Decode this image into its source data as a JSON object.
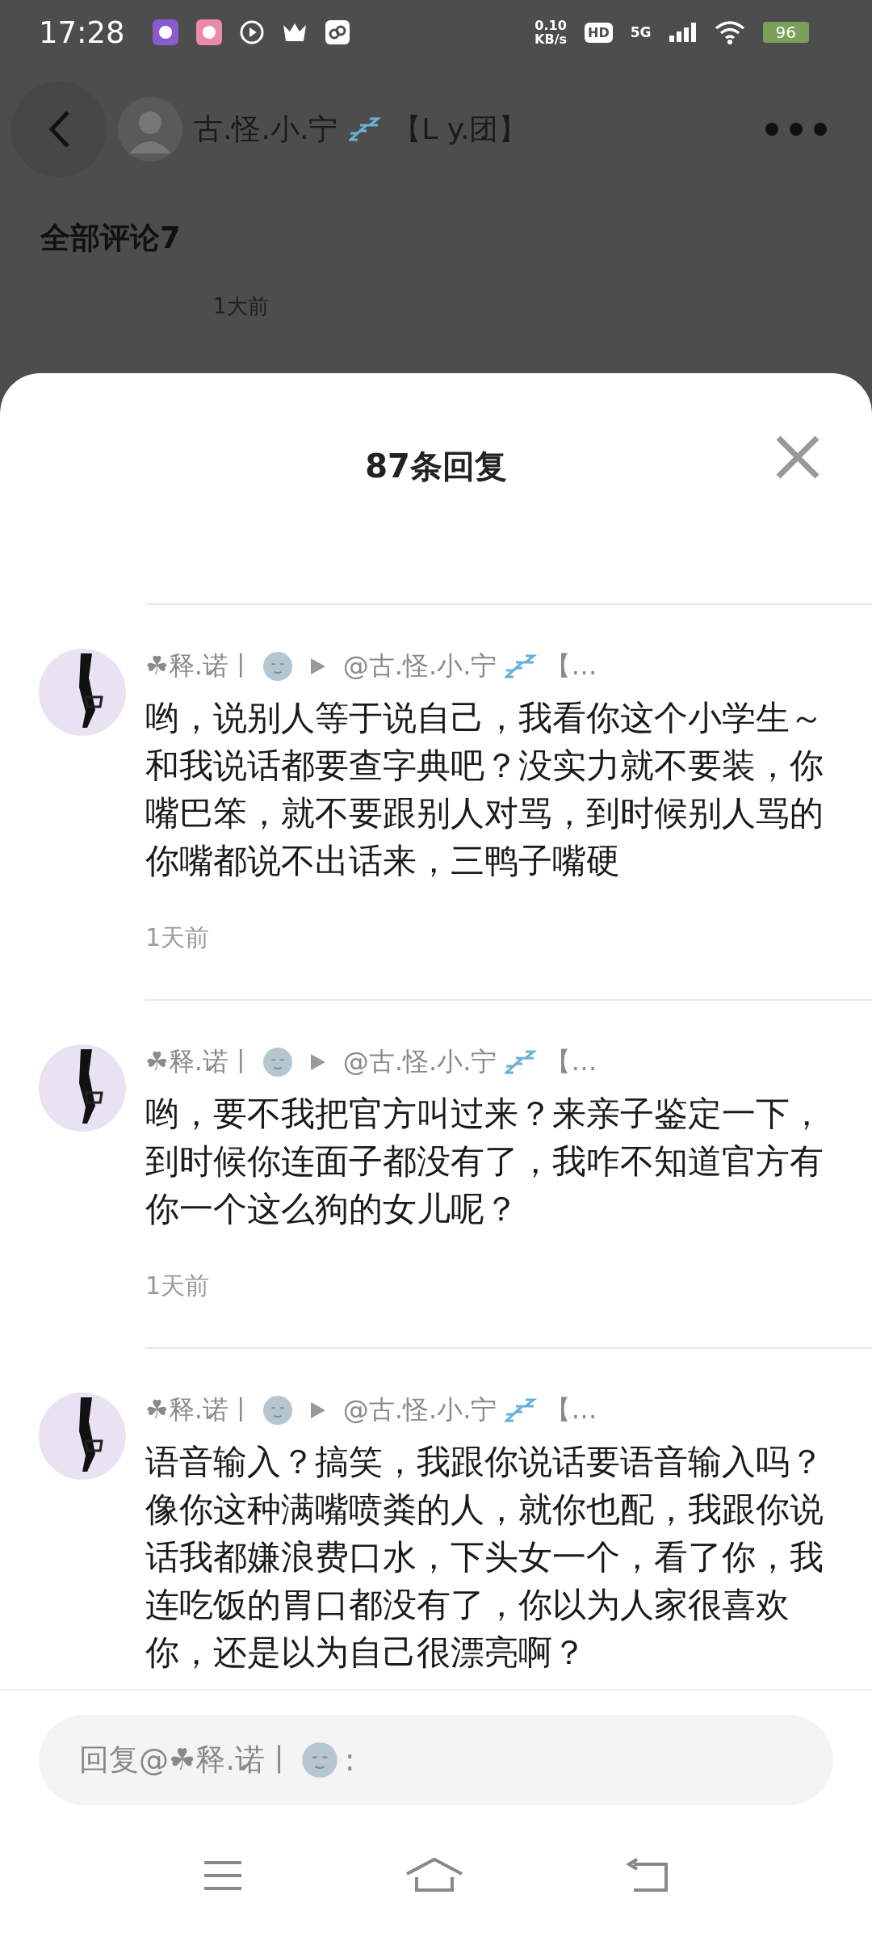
{
  "status_bar": {
    "time": "17:28",
    "speed": "0.10",
    "speed_unit": "KB/s",
    "hd": "HD",
    "network": "5G",
    "battery": "96"
  },
  "header": {
    "title": "古.怪.小.宁",
    "title_end": "【L  y.团】"
  },
  "background": {
    "heading": "全部评论7",
    "time": "1大前"
  },
  "sheet": {
    "title": "87条回复",
    "comments": [
      {
        "author": "☘释.诺丨",
        "reply_to": "@古.怪.小.宁",
        "reply_to_end": "【…",
        "text": "哟，说别人等于说自己，我看你这个小学生～和我说话都要查字典吧？没实力就不要装，你嘴巴笨，就不要跟别人对骂，到时候别人骂的你嘴都说不出话来，三鸭子嘴硬",
        "time": "1天前"
      },
      {
        "author": "☘释.诺丨",
        "reply_to": "@古.怪.小.宁",
        "reply_to_end": "【…",
        "text": "哟，要不我把官方叫过来？来亲子鉴定一下，到时候你连面子都没有了，我咋不知道官方有你一个这么狗的女儿呢？",
        "time": "1天前"
      },
      {
        "author": "☘释.诺丨",
        "reply_to": "@古.怪.小.宁",
        "reply_to_end": "【…",
        "text": "语音输入？搞笑，我跟你说话要语音输入吗？像你这种满嘴喷粪的人，就你也配，我跟你说话我都嫌浪费口水，下头女一个，看了你，我连吃饭的胃口都没有了，你以为人家很喜欢你，还是以为自己很漂亮啊？"
      }
    ],
    "reply": {
      "placeholder": "回复@☘释.诺丨",
      "placeholder_end": ":"
    }
  }
}
